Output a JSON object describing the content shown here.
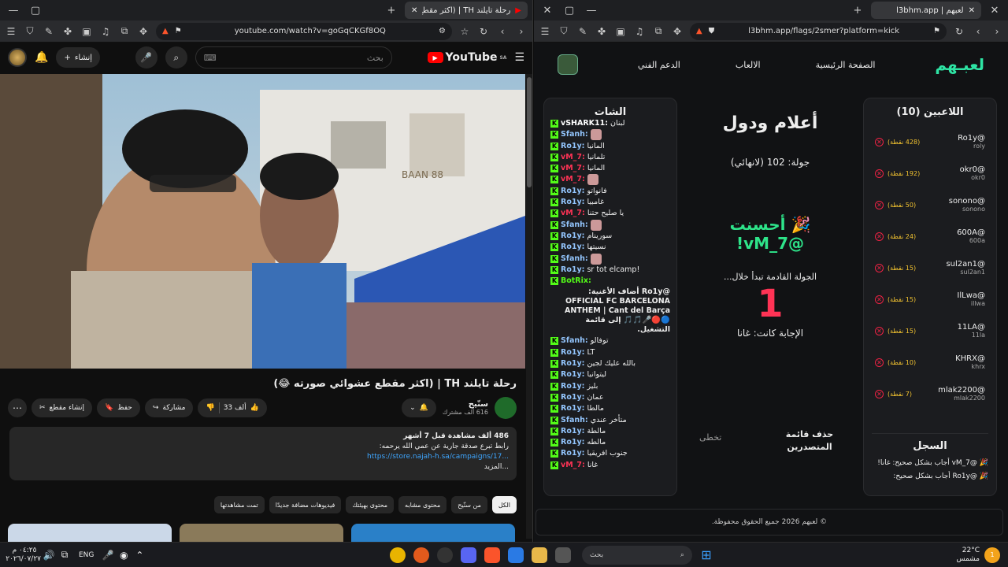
{
  "left_window": {
    "tab_title": "رحلة تايلند TH | (اكثر مقطع عشوائي",
    "url": "youtube.com/watch?v=goGqCKGf8OQ",
    "yt": {
      "logo_text": "YouTube",
      "country": "SA",
      "search_placeholder": "بحث",
      "create_label": "إنشاء"
    },
    "video": {
      "title": "رحلة تايلند TH | (اكثر مقطع عشوائي صورته 😂)",
      "sign_text": "BAAN 88"
    },
    "channel": {
      "name": "سنّيح",
      "subscribers": "616 ألف مشترك"
    },
    "actions": {
      "likes": "33 ألف",
      "share": "مشاركة",
      "save": "حفظ",
      "clip": "إنشاء مقطع"
    },
    "description": {
      "line1": "486 ألف مشاهدة  قبل 7 أشهر",
      "line2": "رابط تبرع صدقة جارية عن عمي الله يرحمه:",
      "link": "https://store.najah-h.sa/campaigns/17...",
      "more": "...المزيد"
    },
    "chips": [
      "الكل",
      "من سنّيح",
      "محتوى مشابه",
      "محتوى بهيئتك",
      "فيديوهات مضافة جديدًا",
      "تمت مشاهدتها"
    ]
  },
  "right_window": {
    "tab_title": "لعبهم | l3bhm.app",
    "url": "l3bhm.app/flags/2smer?platform=kick",
    "logo": "لعبـهم",
    "nav": [
      "الصفحة الرئيسية",
      "الالعاب",
      "الدعم الفني"
    ],
    "players_title": "اللاعبين (10)",
    "players": [
      {
        "name": "@Ro1y",
        "handle": "roly",
        "points": "(428 نقطة)"
      },
      {
        "name": "@okr0",
        "handle": "okr0",
        "points": "(192 نقطة)"
      },
      {
        "name": "@sonono",
        "handle": "sonono",
        "points": "(50 نقطة)"
      },
      {
        "name": "@600A",
        "handle": "600a",
        "points": "(24 نقطة)"
      },
      {
        "name": "@sul2an1",
        "handle": "sul2an1",
        "points": "(15 نقطة)"
      },
      {
        "name": "@IlLwa",
        "handle": "illwa",
        "points": "(15 نقطة)"
      },
      {
        "name": "@11LA",
        "handle": "11la",
        "points": "(15 نقطة)"
      },
      {
        "name": "@KHRX",
        "handle": "khrx",
        "points": "(10 نقطة)"
      },
      {
        "name": "@mlak2200",
        "handle": "mlak2200",
        "points": "(7 نقطة)"
      }
    ],
    "log_title": "السجل",
    "log": [
      "🎉 @vM_7 أجاب بشكل صحيح: غانا!",
      "🎉 @Ro1y أجاب بشكل صحيح:"
    ],
    "game": {
      "title": "أعلام ودول",
      "round": "جولة: 102 (لانهائي)",
      "congrats": "🎉 أحسنت",
      "winner": "@vM_7!",
      "next_round": "الجولة القادمة تبدأ خلال...",
      "countdown": "1",
      "answer": "الإجابة كانت: غانا",
      "delete_board": "حذف قائمة المتصدرين",
      "skip": "تخطى"
    },
    "chat_title": "الشات",
    "chat": [
      {
        "user": "vSHARK11:",
        "msg": "لبنان",
        "color": "#ffffff"
      },
      {
        "user": "Sfanh:",
        "msg": "",
        "emote": true,
        "color": "#93c5fd"
      },
      {
        "user": "Ro1y:",
        "msg": "المانيا",
        "color": "#93c5fd"
      },
      {
        "user": "vM_7:",
        "msg": "تلمانيا",
        "color": "#ff3355"
      },
      {
        "user": "vM_7:",
        "msg": "المانيا",
        "color": "#ff3355"
      },
      {
        "user": "vM_7:",
        "msg": "",
        "emote": true,
        "color": "#ff3355"
      },
      {
        "user": "Ro1y:",
        "msg": "فانواتو",
        "color": "#93c5fd"
      },
      {
        "user": "Ro1y:",
        "msg": "غامبيا",
        "color": "#93c5fd"
      },
      {
        "user": "vM_7:",
        "msg": "يا صليح حتنا",
        "color": "#ff3355"
      },
      {
        "user": "Sfanh:",
        "msg": "",
        "emote": true,
        "color": "#93c5fd"
      },
      {
        "user": "Ro1y:",
        "msg": "سورينام",
        "color": "#93c5fd"
      },
      {
        "user": "Ro1y:",
        "msg": "نسيتها",
        "color": "#93c5fd"
      },
      {
        "user": "Sfanh:",
        "msg": "",
        "emote": true,
        "color": "#93c5fd"
      },
      {
        "user": "Ro1y:",
        "msg": "!sr tot elcamp",
        "color": "#93c5fd"
      },
      {
        "user": "BotRix:",
        "msg": "",
        "color": "#53fc18"
      }
    ],
    "bot_msg": "@Ro1y أضاف الأغنية: OFFICIAL FC BARCELONA ANTHEM | Cant del Barça 🔵🔴🎤🎵🎵 إلى قائمة التشغيل.",
    "chat2": [
      {
        "user": "Sfanh:",
        "msg": "توفالو",
        "color": "#93c5fd"
      },
      {
        "user": "Ro1y:",
        "msg": "LT",
        "color": "#93c5fd"
      },
      {
        "user": "Ro1y:",
        "msg": "بالله عليك لجين",
        "color": "#93c5fd"
      },
      {
        "user": "Ro1y:",
        "msg": "ليتوانيا",
        "color": "#93c5fd"
      },
      {
        "user": "Ro1y:",
        "msg": "بليز",
        "color": "#93c5fd"
      },
      {
        "user": "Ro1y:",
        "msg": "عمان",
        "color": "#93c5fd"
      },
      {
        "user": "Ro1y:",
        "msg": "مالطا",
        "color": "#93c5fd"
      },
      {
        "user": "Sfanh:",
        "msg": "متأخر عندي",
        "color": "#93c5fd"
      },
      {
        "user": "Ro1y:",
        "msg": "مالطة",
        "color": "#93c5fd"
      },
      {
        "user": "Ro1y:",
        "msg": "مالطه",
        "color": "#93c5fd"
      },
      {
        "user": "Ro1y:",
        "msg": "جنوب افريقيا",
        "color": "#93c5fd"
      },
      {
        "user": "vM_7:",
        "msg": "غانا",
        "color": "#ff3355"
      }
    ],
    "footer": "© لعبهم 2026 جميع الحقوق محفوظة."
  },
  "taskbar": {
    "search": "بحث",
    "lang": "ENG",
    "time": "٠٤:٢٥ م",
    "date": "٢٠٢٦/٠٧/٢٧",
    "weather_temp": "22°C",
    "weather_text": "مشمس",
    "notif": "1"
  }
}
